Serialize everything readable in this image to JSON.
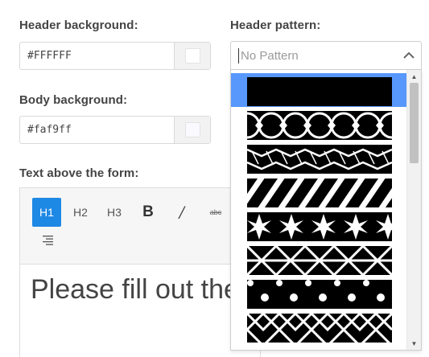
{
  "header_background": {
    "label": "Header background:",
    "value": "#FFFFFF",
    "swatch_color": "#FFFFFF"
  },
  "body_background": {
    "label": "Body background:",
    "value": "#faf9ff",
    "swatch_color": "#faf9ff"
  },
  "text_above": {
    "label": "Text above the form:",
    "toolbar": {
      "h1": "H1",
      "h2": "H2",
      "h3": "H3",
      "bold": "B",
      "italic": "/",
      "strike": "abc"
    },
    "content": "Please fill out the"
  },
  "header_pattern": {
    "label": "Header pattern:",
    "placeholder": "No Pattern",
    "options": [
      "solid",
      "geometric-circles",
      "cubes",
      "diagonal-stripes",
      "stars",
      "lattice",
      "polka-dots",
      "diamond-lattice"
    ],
    "highlighted_index": 0
  },
  "colors": {
    "accent": "#1e88e5",
    "highlight": "#5897fb"
  }
}
